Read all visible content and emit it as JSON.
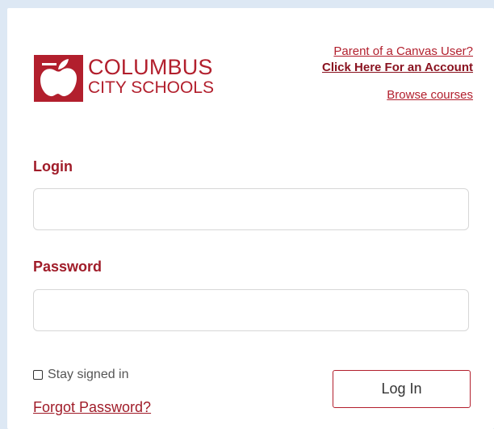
{
  "logo": {
    "line1": "COLUMBUS",
    "line2": "CITY SCHOOLS",
    "icon": "apple-logo-icon",
    "brand_color": "#b21f2d"
  },
  "links": {
    "parent_label": "Parent of a Canvas User?",
    "account_link": "Click Here For an Account",
    "browse_courses": "Browse courses"
  },
  "form": {
    "login_label": "Login",
    "login_value": "",
    "password_label": "Password",
    "password_value": "",
    "stay_signed_in_label": "Stay signed in",
    "stay_signed_in_checked": false,
    "login_button": "Log In",
    "forgot_password": "Forgot Password?"
  },
  "colors": {
    "page_background": "#dde8f4",
    "panel_background": "#ffffff",
    "accent": "#a01c29"
  }
}
